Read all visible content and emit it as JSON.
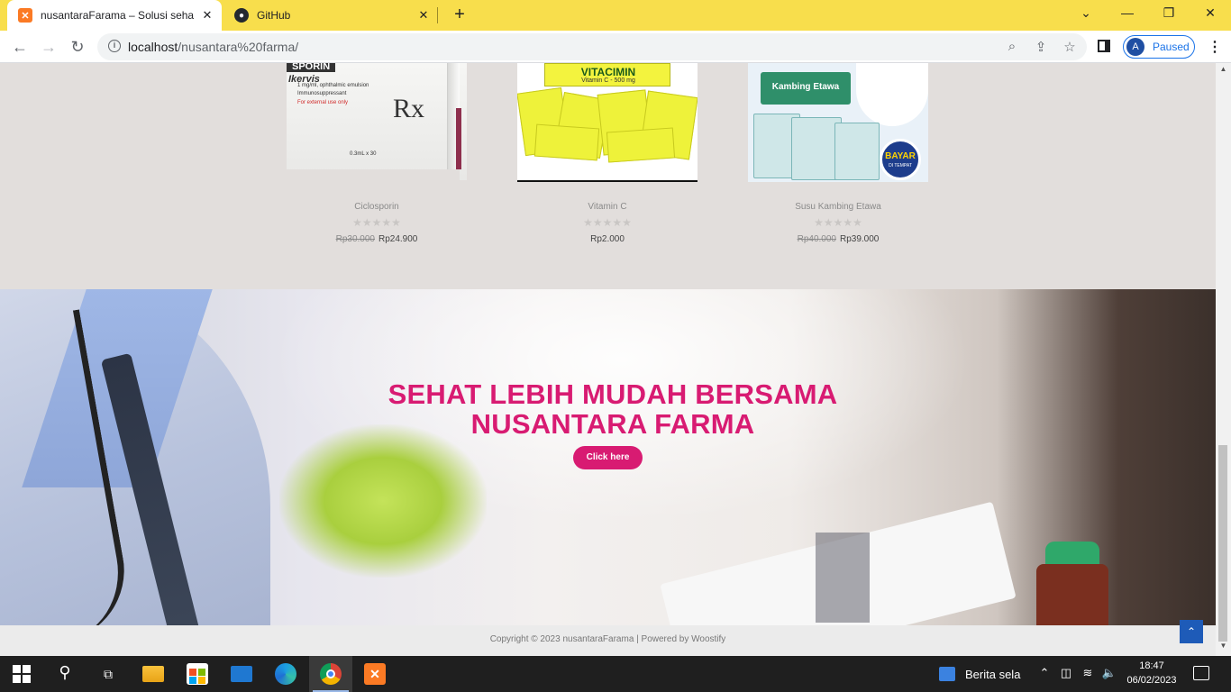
{
  "browser": {
    "tabs": [
      {
        "title": "nusantaraFarama – Solusi sehat k",
        "icon": "xampp-icon",
        "active": true
      },
      {
        "title": "GitHub",
        "icon": "github-icon",
        "active": false
      }
    ],
    "url_host": "localhost",
    "url_path": "/nusantara%20farma/",
    "profile_initial": "A",
    "profile_status": "Paused"
  },
  "products": [
    {
      "name": "Ciclosporin",
      "old_price": "Rp30.000",
      "price": "Rp24.900",
      "rating": 0,
      "image_text": {
        "brand": "Ikervis",
        "line1": "1 mg/ml, ophthalmic emulsion",
        "line2": "Immunosuppressant",
        "line3": "For external use only",
        "line4": "0.3mL x 30",
        "rx": "Rx"
      }
    },
    {
      "name": "Vitamin C",
      "old_price": "",
      "price": "Rp2.000",
      "rating": 0,
      "image_text": {
        "brand": "VITACIMIN",
        "sub": "Vitamin C - 500 mg"
      }
    },
    {
      "name": "Susu Kambing Etawa",
      "old_price": "Rp40.000",
      "price": "Rp39.000",
      "rating": 0,
      "image_text": {
        "brand": "Kambing Etawa",
        "badge": "BAYAR",
        "badge_sub": "DI TEMPAT"
      }
    }
  ],
  "stars_glyph": "★★★★★",
  "hero": {
    "title_line1": "SEHAT LEBIH MUDAH BERSAMA",
    "title_line2": "NUSANTARA FARMA",
    "button": "Click here"
  },
  "footer": {
    "copyright": "Copyright © 2023 nusantaraFarama | Powered by Woostify"
  },
  "taskbar": {
    "news": "Berita sela",
    "time": "18:47",
    "date": "06/02/2023"
  },
  "colors": {
    "accent": "#d81b72",
    "chrome_tab_bar": "#f8de4c",
    "page_bg": "#e2dedc"
  }
}
